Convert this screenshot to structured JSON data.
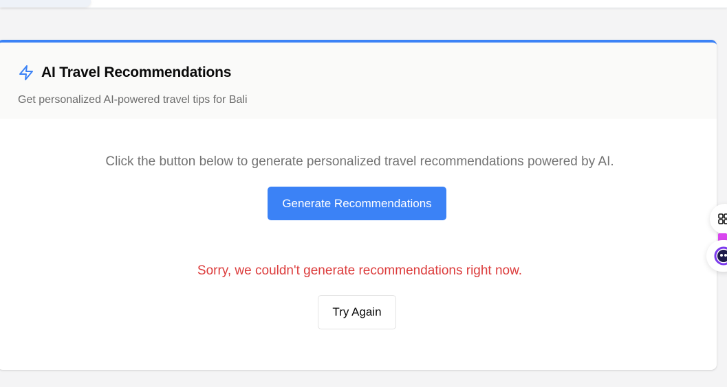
{
  "card": {
    "title": "AI Travel Recommendations",
    "subtitle": "Get personalized AI-powered travel tips for Bali",
    "icon": "lightning-bolt-icon",
    "accent_color": "#3b82f6"
  },
  "body": {
    "intro": "Click the button below to generate personalized travel recommendations powered by AI.",
    "generate_label": "Generate Recommendations",
    "error_message": "Sorry, we couldn't generate recommendations right now.",
    "error_color": "#dc3c3c",
    "retry_label": "Try Again"
  },
  "side_widgets": {
    "apps_icon": "apps-grid-icon",
    "assistant_icon": "assistant-bot-icon"
  }
}
